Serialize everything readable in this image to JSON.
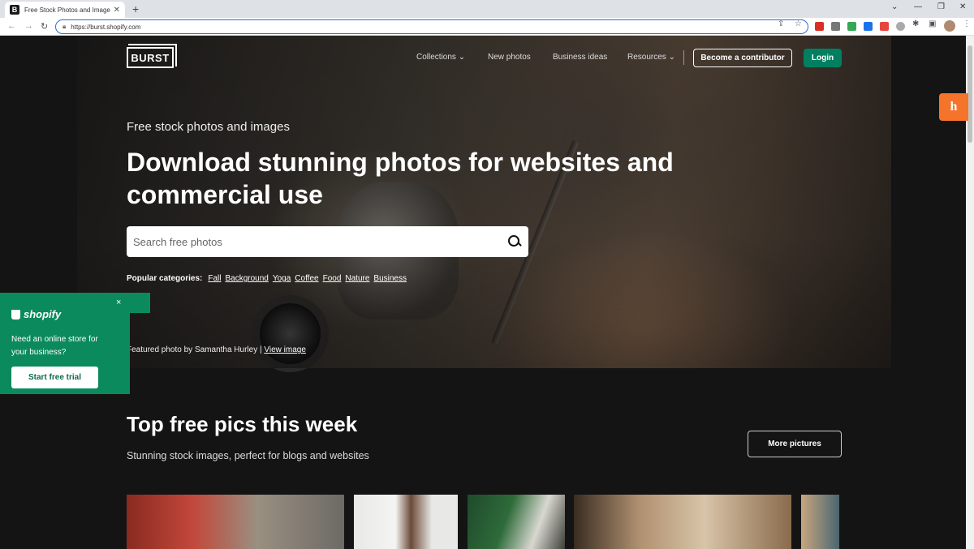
{
  "browser": {
    "tab_title": "Free Stock Photos and Images for",
    "tab_favicon": "B",
    "url": "https://burst.shopify.com"
  },
  "header": {
    "logo": "BURST",
    "nav": {
      "collections": "Collections",
      "new_photos": "New photos",
      "business_ideas": "Business ideas",
      "resources": "Resources"
    },
    "contributor_button": "Become a contributor",
    "login_button": "Login"
  },
  "hero": {
    "kicker": "Free stock photos and images",
    "headline": "Download stunning photos for websites and commercial use",
    "search_placeholder": "Search free photos",
    "popular_label": "Popular categories:",
    "categories": [
      "Fall",
      "Background",
      "Yoga",
      "Coffee",
      "Food",
      "Nature",
      "Business"
    ],
    "credit_text": "Featured photo by Samantha Hurley |",
    "credit_link": "View image"
  },
  "section": {
    "title": "Top free pics this week",
    "subtitle": "Stunning stock images, perfect for blogs and websites",
    "more_button": "More pictures"
  },
  "shopify_popup": {
    "brand": "shopify",
    "text": "Need an online store for your business?",
    "button": "Start free trial",
    "close": "×"
  },
  "honey": {
    "glyph": "h"
  },
  "colors": {
    "accent_green": "#008060",
    "honey_orange": "#f5742b"
  }
}
